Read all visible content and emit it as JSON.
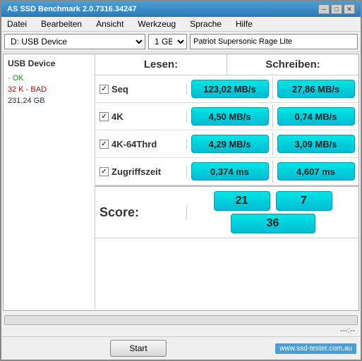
{
  "window": {
    "title": "AS SSD Benchmark 2.0.7316.34247",
    "controls": [
      "minimize",
      "maximize",
      "close"
    ]
  },
  "menu": {
    "items": [
      "Datei",
      "Bearbeiten",
      "Ansicht",
      "Werkzeug",
      "Sprache",
      "Hilfe"
    ]
  },
  "toolbar": {
    "drive": "D: USB Device",
    "size": "1 GB",
    "device_name": "Patriot Supersonic Rage Lite"
  },
  "left_panel": {
    "device": "USB Device",
    "status_ok": "- OK",
    "status_bad": "32 K - BAD",
    "size": "231,24 GB"
  },
  "headers": {
    "read": "Lesen:",
    "write": "Schreiben:"
  },
  "rows": [
    {
      "label": "Seq",
      "checked": true,
      "read": "123,02 MB/s",
      "write": "27,86 MB/s"
    },
    {
      "label": "4K",
      "checked": true,
      "read": "4,50 MB/s",
      "write": "0,74 MB/s"
    },
    {
      "label": "4K-64Thrd",
      "checked": true,
      "read": "4,29 MB/s",
      "write": "3,09 MB/s"
    },
    {
      "label": "Zugriffszeit",
      "checked": true,
      "read": "0,374 ms",
      "write": "4,607 ms"
    }
  ],
  "score": {
    "label": "Score:",
    "read": "21",
    "write": "7",
    "total": "36"
  },
  "progress": {
    "fill_percent": 0,
    "time": "---:--"
  },
  "bottom": {
    "start_label": "Start",
    "watermark": "www.ssd-tester.com.au"
  }
}
